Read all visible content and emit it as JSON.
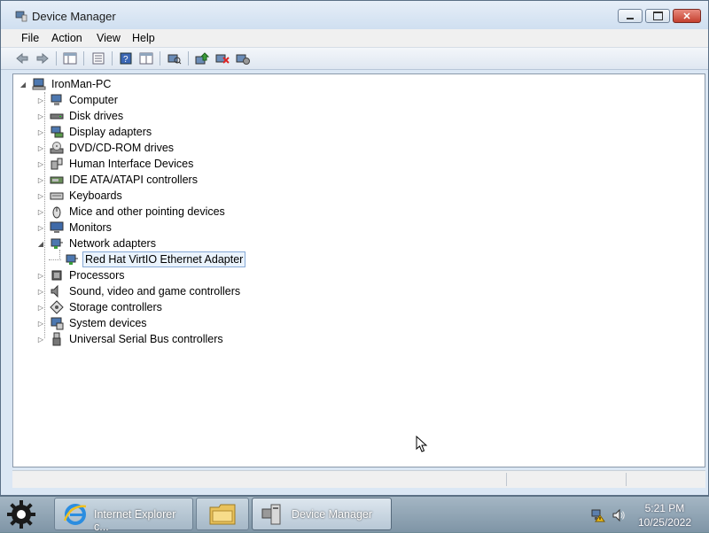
{
  "window": {
    "title": "Device Manager",
    "controls": {
      "minimize": "minimize-icon",
      "maximize": "maximize-icon",
      "close": "✕"
    }
  },
  "menu": [
    "File",
    "Action",
    "View",
    "Help"
  ],
  "toolbar": [
    "back-icon",
    "forward-icon",
    "show-hide-console-tree-icon",
    "properties-icon",
    "help-icon",
    "export-list-icon",
    "scan-hardware-icon",
    "update-driver-icon",
    "uninstall-device-icon",
    "disable-device-icon"
  ],
  "tree": {
    "root": "IronMan-PC",
    "categories": [
      {
        "label": "Computer",
        "icon": "computer-icon",
        "expanded": false
      },
      {
        "label": "Disk drives",
        "icon": "disk-drive-icon",
        "expanded": false
      },
      {
        "label": "Display adapters",
        "icon": "display-adapter-icon",
        "expanded": false
      },
      {
        "label": "DVD/CD-ROM drives",
        "icon": "dvd-drive-icon",
        "expanded": false
      },
      {
        "label": "Human Interface Devices",
        "icon": "hid-icon",
        "expanded": false
      },
      {
        "label": "IDE ATA/ATAPI controllers",
        "icon": "ide-controller-icon",
        "expanded": false
      },
      {
        "label": "Keyboards",
        "icon": "keyboard-icon",
        "expanded": false
      },
      {
        "label": "Mice and other pointing devices",
        "icon": "mouse-icon",
        "expanded": false
      },
      {
        "label": "Monitors",
        "icon": "monitor-icon",
        "expanded": false
      },
      {
        "label": "Network adapters",
        "icon": "network-adapter-icon",
        "expanded": true
      },
      {
        "label": "Red Hat VirtIO Ethernet Adapter",
        "icon": "network-adapter-icon",
        "child": true,
        "selected": true
      },
      {
        "label": "Processors",
        "icon": "processor-icon",
        "expanded": false
      },
      {
        "label": "Sound, video and game controllers",
        "icon": "sound-icon",
        "expanded": false
      },
      {
        "label": "Storage controllers",
        "icon": "storage-controller-icon",
        "expanded": false
      },
      {
        "label": "System devices",
        "icon": "system-device-icon",
        "expanded": false
      },
      {
        "label": "Universal Serial Bus controllers",
        "icon": "usb-icon",
        "expanded": false
      }
    ]
  },
  "taskbar": {
    "tasks": [
      {
        "label": "Internet Explorer c...",
        "icon": "internet-explorer-icon"
      },
      {
        "label": "",
        "icon": "windows-explorer-icon"
      },
      {
        "label": "Device Manager",
        "icon": "device-manager-icon",
        "active": true
      }
    ],
    "time": "5:21 PM",
    "date": "10/25/2022"
  },
  "colors": {
    "selection_border": "#86a9d6",
    "selection_bg": "#eaf3fc",
    "window_frame": "#dbe7f4"
  }
}
